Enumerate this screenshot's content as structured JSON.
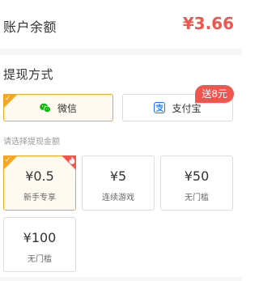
{
  "balance": {
    "label": "账户余额",
    "value": "¥3.66",
    "value_color": "#f2554e"
  },
  "withdraw": {
    "section_title": "提现方式",
    "methods": [
      {
        "label": "微信",
        "icon": "wechat-icon",
        "selected": true
      },
      {
        "label": "支付宝",
        "icon": "alipay-icon",
        "selected": false
      }
    ],
    "bonus_badge": "送8元",
    "amount_hint": "请选择提现金额",
    "amounts": [
      {
        "value": "¥0.5",
        "sub": "新手专享",
        "selected": true,
        "hot": true
      },
      {
        "value": "¥5",
        "sub": "连续游戏",
        "selected": false,
        "hot": false
      },
      {
        "value": "¥50",
        "sub": "无门槛",
        "selected": false,
        "hot": false
      },
      {
        "value": "¥100",
        "sub": "无门槛",
        "selected": false,
        "hot": false
      }
    ]
  },
  "colors": {
    "accent_orange": "#f6a623",
    "accent_red": "#f2554e",
    "wechat_green": "#09bb07",
    "alipay_blue": "#1677ff"
  }
}
